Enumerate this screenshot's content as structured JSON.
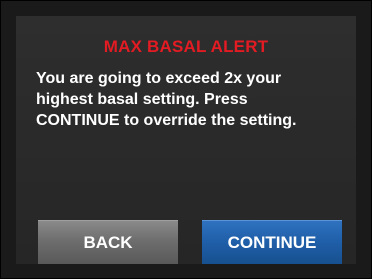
{
  "alert": {
    "title": "MAX BASAL ALERT",
    "message": "You are going to exceed 2x your\nhighest basal setting. Press\nCONTINUE to override the setting."
  },
  "buttons": {
    "back_label": "BACK",
    "continue_label": "CONTINUE"
  },
  "colors": {
    "title": "#e31b23",
    "screen_background": "#2a2a2a",
    "frame": "#1a1a1a",
    "back_button": "#6e6e6e",
    "continue_button": "#1f5ea8",
    "text": "#ffffff"
  }
}
